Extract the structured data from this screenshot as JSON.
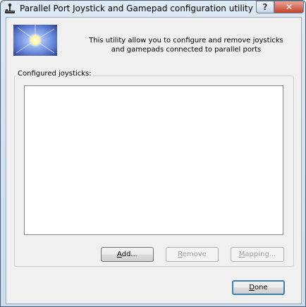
{
  "window": {
    "title": "Parallel Port Joystick and Gamepad configuration utility",
    "icon": "joystick-icon"
  },
  "caption_buttons": {
    "help": "?",
    "close": "✕"
  },
  "banner": {
    "image": "blue-flower-image",
    "line1": "This utility allow you to configure and remove joysticks",
    "line2": "and gamepads connected to parallel ports"
  },
  "group": {
    "label": "Configured joysticks:",
    "items": []
  },
  "buttons": {
    "add": {
      "mnemonic": "A",
      "rest": "dd...",
      "enabled": true
    },
    "remove": {
      "mnemonic": "R",
      "rest": "emove",
      "enabled": false
    },
    "mapping": {
      "mnemonic": "M",
      "rest": "apping...",
      "enabled": false
    },
    "done": {
      "mnemonic": "D",
      "rest": "one",
      "enabled": true,
      "default": true
    }
  },
  "colors": {
    "close_button": "#c4422b",
    "default_button_border": "#3c7fb1",
    "disabled_text": "#a0a0a0"
  }
}
